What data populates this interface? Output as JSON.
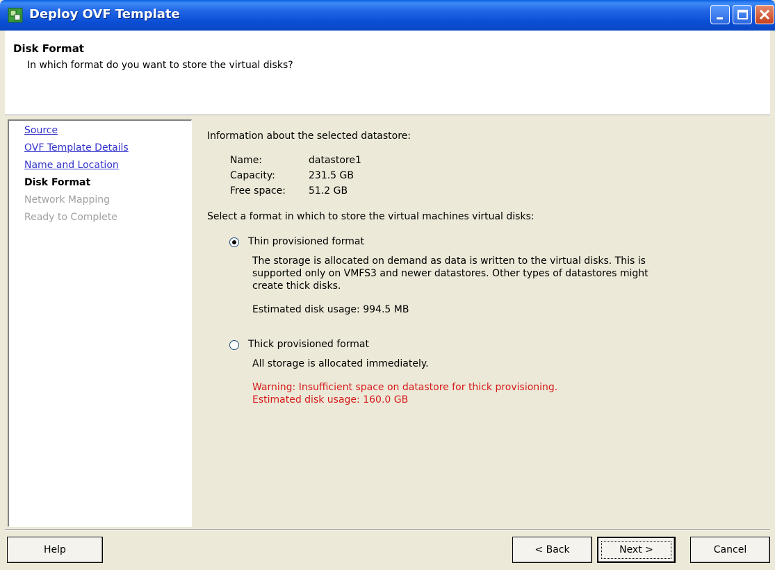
{
  "window": {
    "title": "Deploy OVF Template"
  },
  "header": {
    "title": "Disk Format",
    "description": "In which format do you want to store the virtual disks?"
  },
  "nav": {
    "items": [
      {
        "label": "Source",
        "state": "link"
      },
      {
        "label": "OVF Template Details",
        "state": "link"
      },
      {
        "label": "Name and Location",
        "state": "link"
      },
      {
        "label": "Disk Format",
        "state": "current"
      },
      {
        "label": "Network Mapping",
        "state": "disabled"
      },
      {
        "label": "Ready to Complete",
        "state": "disabled"
      }
    ]
  },
  "datastore": {
    "heading": "Information about the selected datastore:",
    "name_label": "Name:",
    "name_value": "datastore1",
    "capacity_label": "Capacity:",
    "capacity_value": "231.5 GB",
    "free_label": "Free space:",
    "free_value": "51.2 GB"
  },
  "format": {
    "prompt": "Select a format in which to store the virtual machines virtual disks:",
    "thin": {
      "label": "Thin provisioned format",
      "selected": true,
      "desc_line1": "The storage is allocated on demand as data is written to the virtual disks. This is",
      "desc_line2": "supported only on VMFS3 and newer datastores. Other types of datastores might",
      "desc_line3": "create thick disks.",
      "usage": "Estimated disk usage: 994.5 MB"
    },
    "thick": {
      "label": "Thick provisioned format",
      "selected": false,
      "desc": "All storage is allocated immediately.",
      "warning": "Warning: Insufficient space on datastore for thick provisioning.",
      "usage": "Estimated disk usage: 160.0 GB"
    }
  },
  "buttons": {
    "help": "Help",
    "back": "< Back",
    "next": "Next >",
    "cancel": "Cancel"
  },
  "colors": {
    "titlebar": "#0b4fd6",
    "link": "#3333cc",
    "warning": "#d61a1a",
    "disabled": "#a0a0a0"
  },
  "icons": {
    "app": "vsphere-app-icon",
    "minimize": "minimize-icon",
    "maximize": "maximize-icon",
    "close": "close-icon"
  }
}
